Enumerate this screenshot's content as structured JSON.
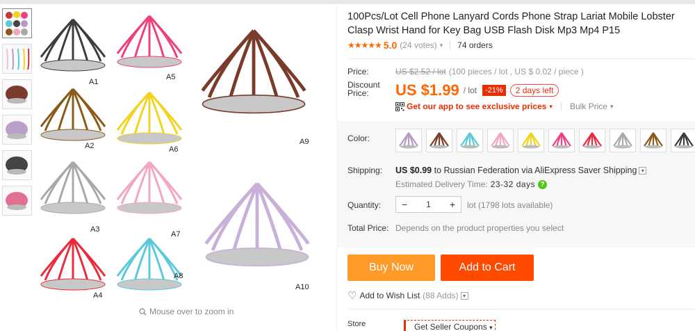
{
  "gallery": {
    "zoom_hint": "Mouse over to zoom in",
    "image_labels": [
      "A1",
      "A5",
      "A9",
      "A2",
      "A6",
      "A3",
      "A7",
      "A4",
      "A8",
      "A10"
    ],
    "thumb_colors": [
      "#c43a3a",
      "#f4c2c2",
      "#7a3b2a",
      "#b9a0c8",
      "#444444",
      "#e07090"
    ]
  },
  "product": {
    "title": "100Pcs/Lot Cell Phone Lanyard Cords Phone Strap Lariat Mobile Lobster Clasp Wrist Hand for Key Bag USB Flash Disk Mp3 Mp4 P15",
    "stars": "★★★★★",
    "rating": "5.0",
    "votes": "(24 votes)",
    "orders": "74 orders"
  },
  "pricing": {
    "price_label": "Price:",
    "original_price": "US $2.52 / lot",
    "original_note": "(100 pieces / lot , US $ 0.02 / piece )",
    "discount_label_1": "Discount",
    "discount_label_2": "Price:",
    "discount_price": "US $1.99",
    "per_lot": "/ lot",
    "discount_pct": "-21%",
    "days_left": "2 days left",
    "app_promo": "Get our app to see exclusive prices",
    "bulk_price": "Bulk Price"
  },
  "options": {
    "color_label": "Color:",
    "swatch_colors": [
      "#b59ac6",
      "#7b3f2c",
      "#5bc8dc",
      "#f2a6c0",
      "#f3d320",
      "#ee3f7e",
      "#ea2b3b",
      "#a8a8a8",
      "#8a5a18",
      "#3c3c3c"
    ],
    "shipping_label": "Shipping:",
    "shipping_cost": "US $0.99",
    "shipping_to": "to Russian Federation via AliExpress Saver Shipping",
    "delivery_label": "Estimated Delivery Time:",
    "delivery_days": "23-32 days",
    "quantity_label": "Quantity:",
    "quantity_value": "1",
    "quantity_available": "lot (1798 lots available)",
    "total_label": "Total Price:",
    "total_desc": "Depends on the product properties you select"
  },
  "actions": {
    "buy_now": "Buy Now",
    "add_to_cart": "Add to Cart",
    "wish_list": "Add to Wish List",
    "wish_adds": "(88 Adds)"
  },
  "store": {
    "label": "Store",
    "coupon": "Get Seller Coupons"
  }
}
